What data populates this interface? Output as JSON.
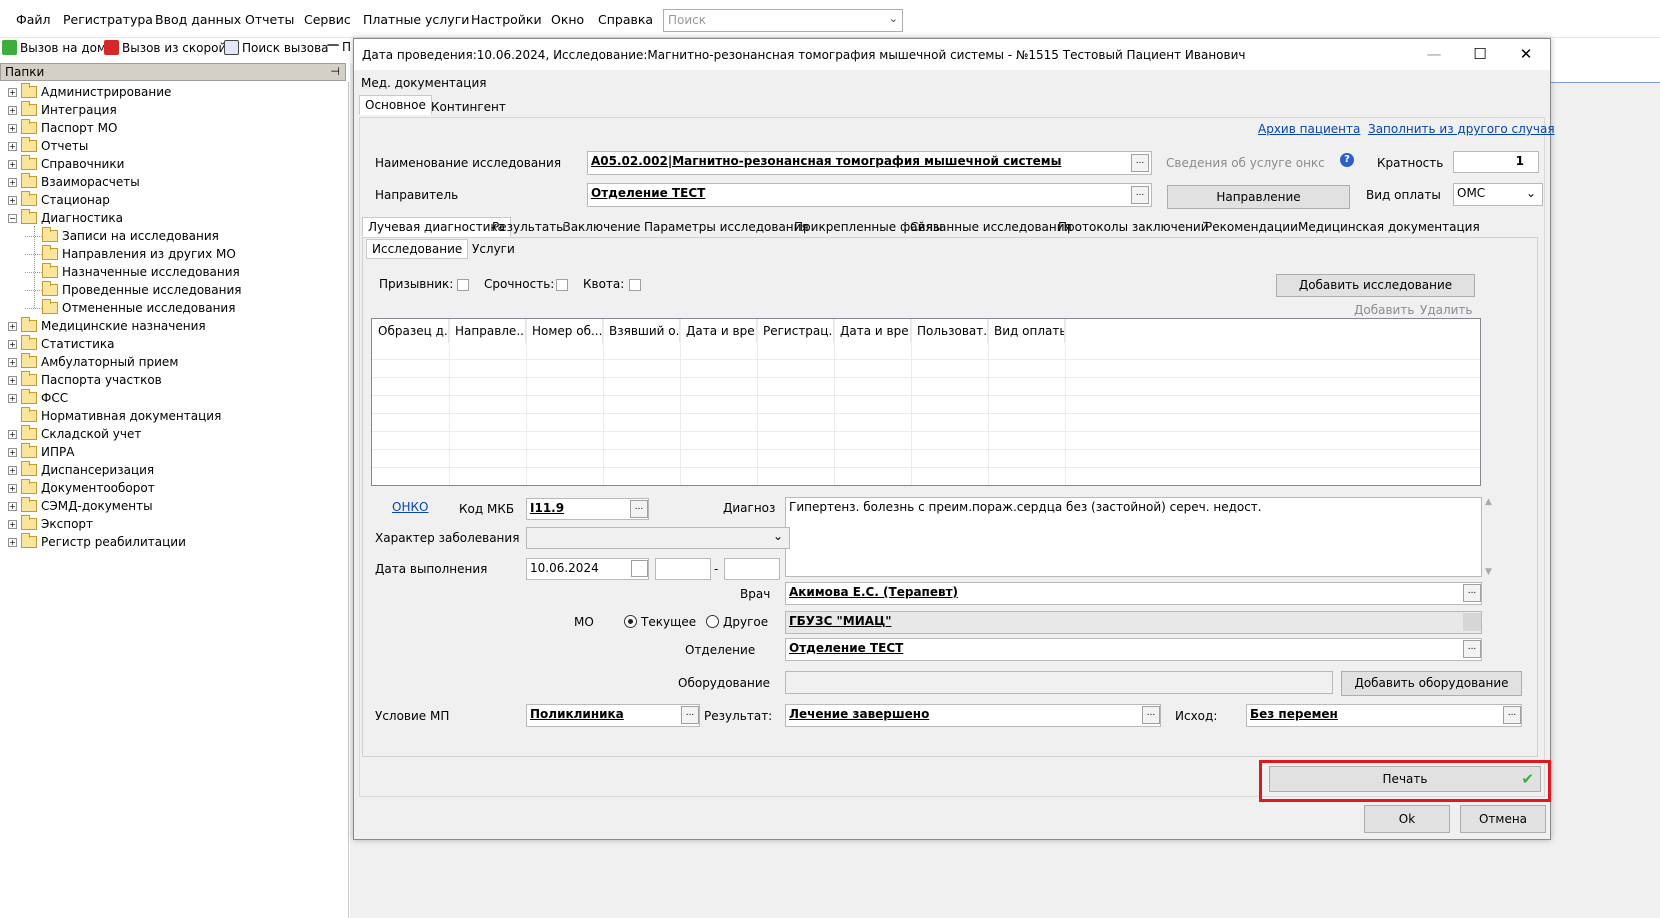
{
  "menu": [
    "Файл",
    "Регистратура",
    "Ввод данных",
    "Отчеты",
    "Сервис",
    "Платные услуги",
    "Настройки",
    "Окно",
    "Справка"
  ],
  "search": {
    "placeholder": "Поиск"
  },
  "toolbar": {
    "call_home": "Вызов на дом",
    "call_ambulance": "Вызов из скорой",
    "call_search": "Поиск вызова",
    "more": "П"
  },
  "panel": {
    "title": "Папки"
  },
  "tree": [
    {
      "label": "Администрирование",
      "level": 0,
      "expanded": false
    },
    {
      "label": "Интеграция",
      "level": 0,
      "expanded": false
    },
    {
      "label": "Паспорт МО",
      "level": 0,
      "expanded": false
    },
    {
      "label": "Отчеты",
      "level": 0,
      "expanded": false
    },
    {
      "label": "Справочники",
      "level": 0,
      "expanded": false
    },
    {
      "label": "Взаиморасчеты",
      "level": 0,
      "expanded": false
    },
    {
      "label": "Стационар",
      "level": 0,
      "expanded": false
    },
    {
      "label": "Диагностика",
      "level": 0,
      "expanded": true
    },
    {
      "label": "Записи на исследования",
      "level": 1
    },
    {
      "label": "Направления из других МО",
      "level": 1
    },
    {
      "label": "Назначенные исследования",
      "level": 1
    },
    {
      "label": "Проведенные исследования",
      "level": 1
    },
    {
      "label": "Отмененные исследования",
      "level": 1
    },
    {
      "label": "Медицинские назначения",
      "level": 0,
      "expanded": false
    },
    {
      "label": "Статистика",
      "level": 0,
      "expanded": false
    },
    {
      "label": "Амбулаторный прием",
      "level": 0,
      "expanded": false
    },
    {
      "label": "Паспорта участков",
      "level": 0,
      "expanded": false
    },
    {
      "label": "ФСС",
      "level": 0,
      "expanded": false
    },
    {
      "label": "Нормативная документация",
      "level": 0,
      "noexp": true
    },
    {
      "label": "Складской учет",
      "level": 0,
      "expanded": false
    },
    {
      "label": "ИПРА",
      "level": 0,
      "expanded": false
    },
    {
      "label": "Диспансеризация",
      "level": 0,
      "expanded": false
    },
    {
      "label": "Документооборот",
      "level": 0,
      "expanded": false
    },
    {
      "label": "СЭМД-документы",
      "level": 0,
      "expanded": false
    },
    {
      "label": "Экспорт",
      "level": 0,
      "expanded": false
    },
    {
      "label": "Регистр реабилитации",
      "level": 0,
      "expanded": false
    }
  ],
  "dialog": {
    "title": "Дата проведения:10.06.2024, Исследование:Магнитно-резонансная томография мышечной системы - №1515 Тестовый Пациент Иванович",
    "subtitle": "Мед. документация",
    "top_tabs": [
      "Основное",
      "Контингент"
    ],
    "link_archive": "Архив пациента",
    "link_fill": "Заполнить из другого случая",
    "study_name_label": "Наименование исследования",
    "study_name_value": "A05.02.002|Магнитно-резонансная томография мышечной системы",
    "service_info": "Сведения об услуге онкс",
    "multiplicity_label": "Кратность",
    "multiplicity_value": "1",
    "referrer_label": "Направитель",
    "referrer_value": "Отделение ТЕСТ",
    "referral_button": "Направление",
    "payment_label": "Вид оплаты",
    "payment_value": "ОМС",
    "inner_tabs": [
      "Лучевая диагностика",
      "Результаты",
      "Заключение",
      "Параметры исследования",
      "Прикрепленные файлы",
      "Связанные исследования",
      "Протоколы заключений",
      "Рекомендации",
      "Медицинская документация"
    ],
    "sub_tabs": [
      "Исследование",
      "Услуги"
    ],
    "conscript": "Призывник:",
    "urgency": "Срочность:",
    "quota": "Квота:",
    "add_study_button": "Добавить исследование",
    "add_link": "Добавить",
    "delete_link": "Удалить",
    "grid_headers": [
      "Образец д...",
      "Направле...",
      "Номер об...",
      "Взявший о...",
      "Дата и вре...",
      "Регистрац...",
      "Дата и вре...",
      "Пользоват...",
      "Вид оплаты"
    ],
    "onko": "ОНКО",
    "icd_label": "Код МКБ",
    "icd_value": "I11.9",
    "diagnosis_label": "Диагноз",
    "diagnosis_value": "Гипертенз. болезнь с преим.пораж.сердца без (застойной) сереч. недост.",
    "disease_nature_label": "Характер заболевания",
    "done_date_label": "Дата выполнения",
    "done_date_value": "10.06.2024",
    "date_sep": "-",
    "doctor_label": "Врач",
    "doctor_value": "Акимова Е.С. (Терапевт)",
    "mo_label": "МО",
    "mo_current": "Текущее",
    "mo_other": "Другое",
    "mo_value": "ГБУЗС \"МИАЦ\"",
    "department_label": "Отделение",
    "department_value": "Отделение ТЕСТ",
    "equipment_label": "Оборудование",
    "add_equipment_button": "Добавить оборудование",
    "condition_label": "Условие МП",
    "condition_value": "Поликлиника",
    "result_label": "Результат:",
    "result_value": "Лечение завершено",
    "outcome_label": "Исход:",
    "outcome_value": "Без перемен",
    "print_button": "Печать",
    "ok_button": "Ok",
    "cancel_button": "Отмена"
  },
  "colors": {
    "link": "#0645ad",
    "highlight": "#e0191e",
    "check": "#3cae3c"
  }
}
